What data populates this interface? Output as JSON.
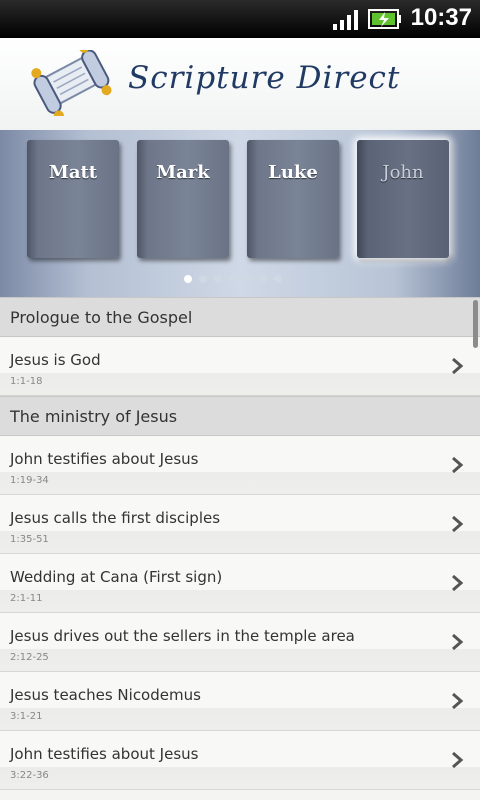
{
  "status_bar": {
    "time": "10:37"
  },
  "header": {
    "app_name": "Scripture Direct"
  },
  "carousel": {
    "books": [
      "Matt",
      "Mark",
      "Luke",
      "John"
    ],
    "selected": "John",
    "page_count": 7,
    "current_page": 1
  },
  "sections": [
    {
      "title": "Prologue to the Gospel",
      "items": [
        {
          "title": "Jesus is God",
          "ref": "1:1-18"
        }
      ]
    },
    {
      "title": "The ministry of Jesus",
      "items": [
        {
          "title": "John testifies about Jesus",
          "ref": "1:19-34"
        },
        {
          "title": "Jesus calls the first disciples",
          "ref": "1:35-51"
        },
        {
          "title": "Wedding at Cana (First sign)",
          "ref": "2:1-11"
        },
        {
          "title": "Jesus drives out the sellers in the temple area",
          "ref": "2:12-25"
        },
        {
          "title": "Jesus teaches Nicodemus",
          "ref": "3:1-21"
        },
        {
          "title": "John testifies about Jesus",
          "ref": "3:22-36"
        }
      ]
    }
  ]
}
